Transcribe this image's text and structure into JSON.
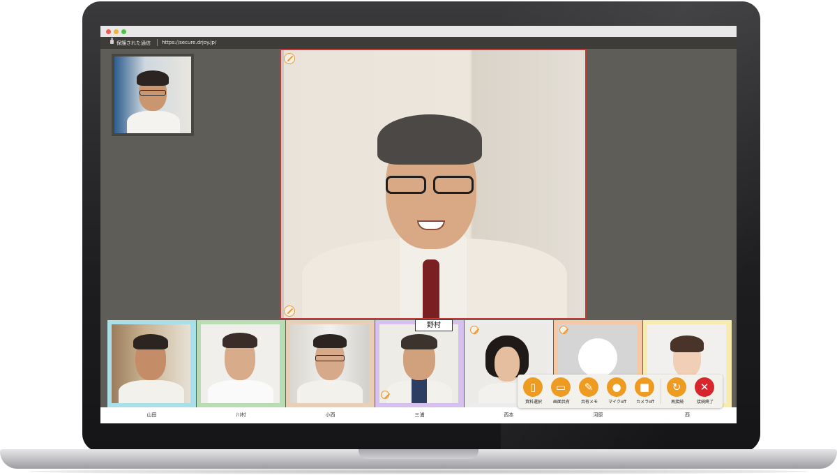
{
  "browser": {
    "secure_label": "保護された通信",
    "url": "https://secure.drjoy.jp/"
  },
  "speaker_tag": "野村",
  "participants": [
    {
      "name": "山田",
      "frame_color": "#a8dfe8"
    },
    {
      "name": "川村",
      "frame_color": "#b9ddb2"
    },
    {
      "name": "小西",
      "frame_color": "#eacfb7"
    },
    {
      "name": "三浦",
      "frame_color": "#d5c0ee"
    },
    {
      "name": "西本",
      "frame_color": "#ececec"
    },
    {
      "name": "河原",
      "frame_color": "#f6c9a6"
    },
    {
      "name": "西",
      "frame_color": "#f7ebb0"
    }
  ],
  "toolbar": {
    "doc_select": "資料選択",
    "screen_share": "画面共有",
    "shared_memo": "共有メモ",
    "mic_off": "マイクoff",
    "camera_off": "カメラoff",
    "reconnect": "再接続",
    "end_call": "接続終了"
  },
  "colors": {
    "accent": "#ee9b22",
    "end_call": "#d8262d",
    "active_border": "#c03a3a"
  }
}
